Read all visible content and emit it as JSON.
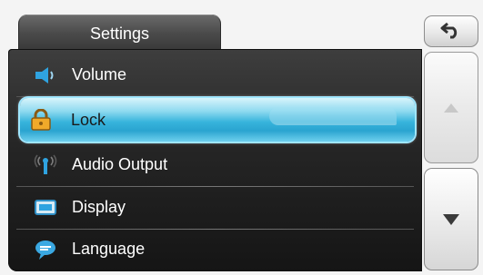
{
  "tab": {
    "title": "Settings"
  },
  "menu": {
    "items": [
      {
        "label": "Volume",
        "icon": "speaker-icon",
        "selected": false
      },
      {
        "label": "Lock",
        "icon": "padlock-icon",
        "selected": true
      },
      {
        "label": "Audio Output",
        "icon": "antenna-icon",
        "selected": false
      },
      {
        "label": "Display",
        "icon": "monitor-icon",
        "selected": false
      },
      {
        "label": "Language",
        "icon": "speech-bubble-icon",
        "selected": false
      }
    ]
  },
  "controls": {
    "back_icon": "back-arrow-icon",
    "up_icon": "arrow-up-icon",
    "down_icon": "arrow-down-icon"
  },
  "colors": {
    "highlight": "#37b4dc",
    "panel": "#252525",
    "tab": "#4a4a4a"
  }
}
